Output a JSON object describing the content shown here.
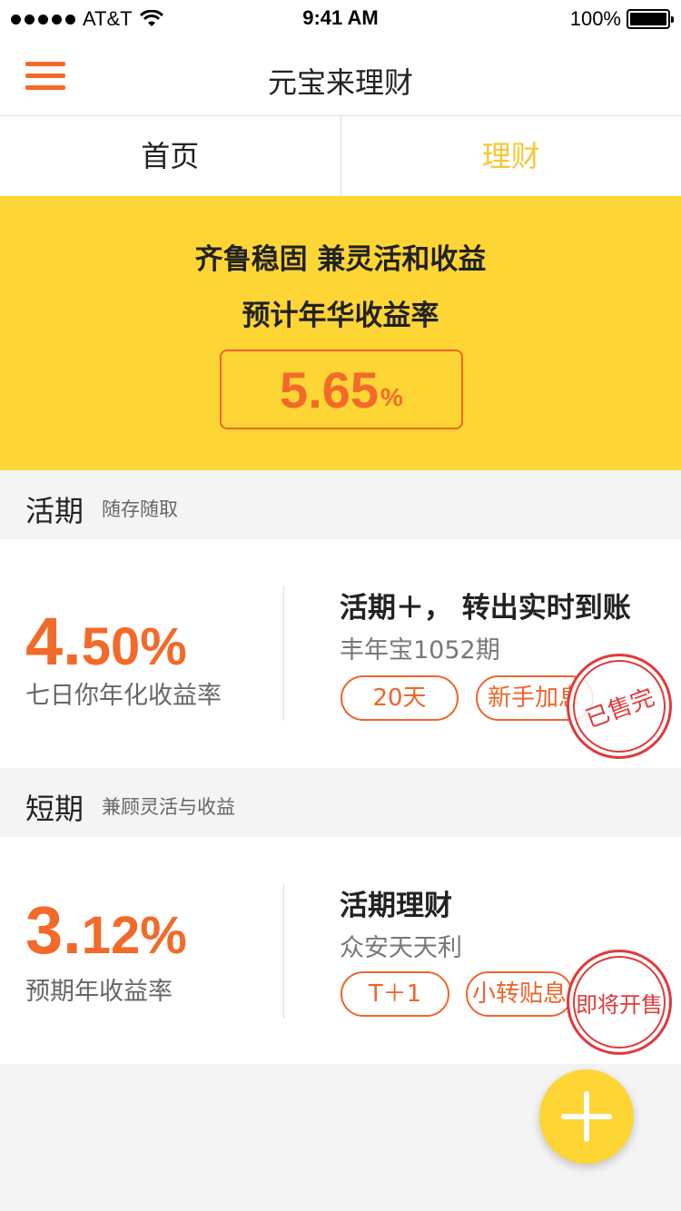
{
  "status_bar": {
    "carrier": "AT&T",
    "time": "9:41 AM",
    "battery": "100%"
  },
  "nav": {
    "title": "元宝来理财",
    "menu_icon": "hamburger-icon"
  },
  "tabs": [
    {
      "label": "首页",
      "active": false
    },
    {
      "label": "理财",
      "active": true
    }
  ],
  "banner": {
    "line1": "齐鲁稳固 兼灵活和收益",
    "line2": "预计年华收益率",
    "rate": "5.65",
    "unit": "%"
  },
  "sections": [
    {
      "title": "活期",
      "subtitle": "随存随取",
      "card": {
        "rate_int": "4.",
        "rate_frac": "50%",
        "rate_label": "七日你年化收益率",
        "product_name": "活期＋， 转出实时到账",
        "product_sub": "丰年宝1052期",
        "tags": [
          "20天",
          "新手加息"
        ],
        "stamp": "已售完"
      }
    },
    {
      "title": "短期",
      "subtitle": "兼顾灵活与收益",
      "card": {
        "rate_int": "3.",
        "rate_frac": "12%",
        "rate_label": "预期年收益率",
        "product_name": "活期理财",
        "product_sub": "众安天天利",
        "tags": [
          "T＋1",
          "小转贴息"
        ],
        "stamp": "即将开售"
      }
    }
  ],
  "colors": {
    "accent": "#f26a2a",
    "banner": "#fdd535",
    "active_tab": "#f8c636",
    "stamp": "#e03a3a"
  },
  "fab_icon": "plus-icon"
}
